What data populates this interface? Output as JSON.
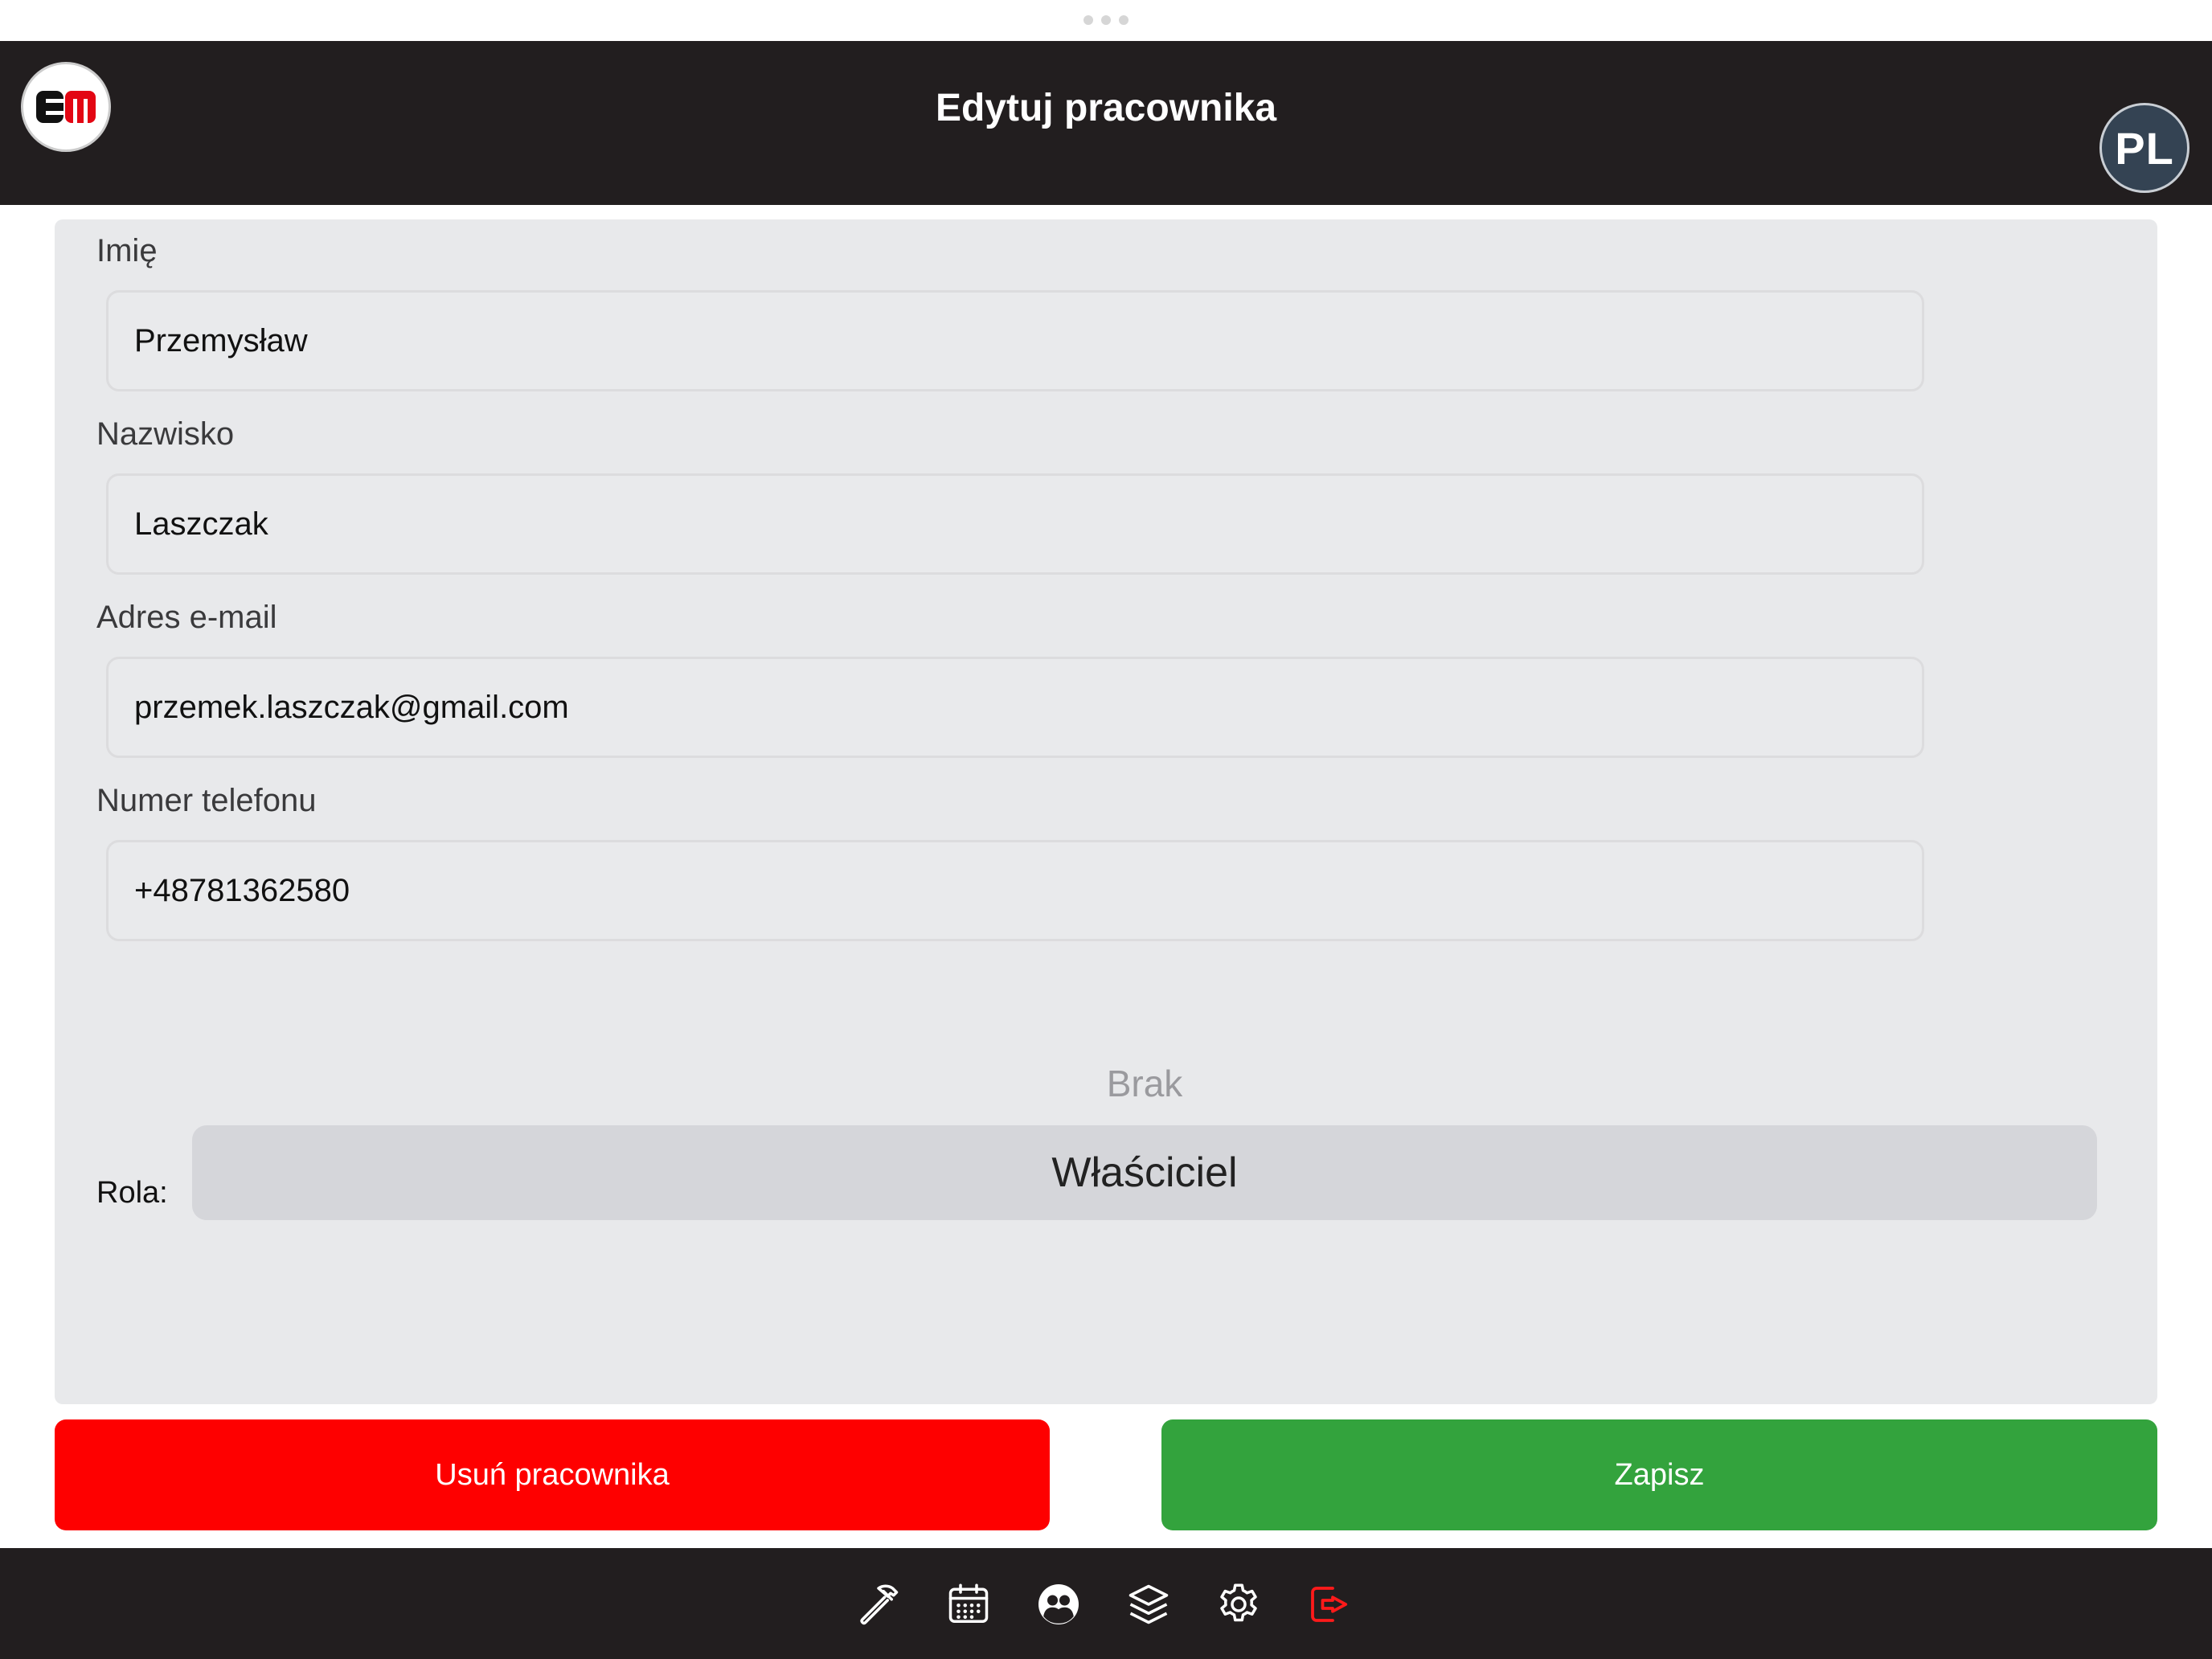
{
  "header": {
    "title": "Edytuj pracownika",
    "avatar_initials": "PL",
    "logo_text": "EM"
  },
  "form": {
    "first_name": {
      "label": "Imię",
      "value": "Przemysław"
    },
    "last_name": {
      "label": "Nazwisko",
      "value": "Laszczak"
    },
    "email": {
      "label": "Adres e-mail",
      "value": "przemek.laszczak@gmail.com"
    },
    "phone": {
      "label": "Numer telefonu",
      "value": "+48781362580"
    },
    "role": {
      "label": "Rola:",
      "option_above": "Brak",
      "selected": "Właściciel"
    }
  },
  "actions": {
    "delete_label": "Usuń pracownika",
    "save_label": "Zapisz"
  },
  "tabbar": {
    "icons": [
      "hammer-icon",
      "calendar-icon",
      "users-icon",
      "layers-icon",
      "gear-icon",
      "logout-icon"
    ],
    "accent_logout": "#ff1a1a"
  },
  "colors": {
    "header_bg": "#221e1f",
    "delete": "#fe0000",
    "save": "#33a33d",
    "panel": "#e8e9eb"
  }
}
